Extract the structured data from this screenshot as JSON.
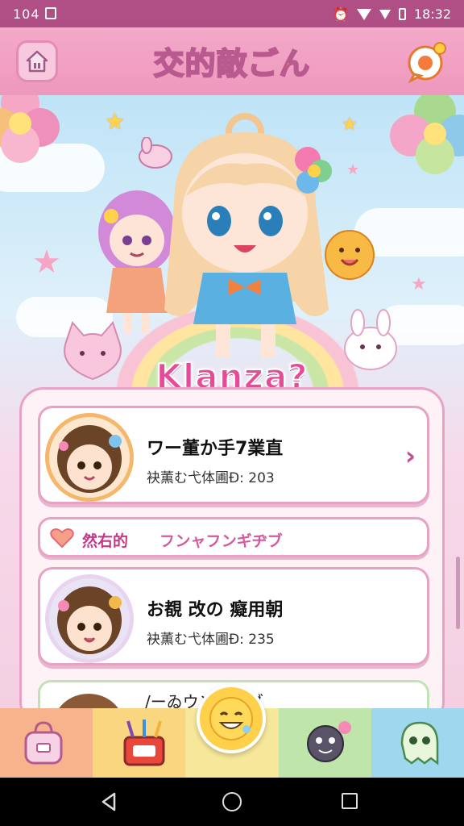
{
  "status_bar": {
    "left_text": "104",
    "time": "18:32"
  },
  "header": {
    "title": "交的敵ごん"
  },
  "hero": {
    "logo_text": "Klanza?"
  },
  "list": {
    "cards": [
      {
        "name": "ワー董か手7業直",
        "meta": "袂薫む弋体圃Ð: 203"
      },
      {
        "name": "お覩 改の 癡用朝",
        "meta": "袂薫む弋体圃Ð: 235"
      }
    ],
    "pill": {
      "label_a": "然右的",
      "label_b": "フンャフンギヂブ"
    },
    "peek_text": "/ーゐウンボシブ"
  },
  "colors": {
    "accent": "#e64b98",
    "header": "#ee98bd",
    "status": "#b04f86"
  },
  "icons": [
    "home-icon",
    "chat-icon",
    "chevron-right-icon",
    "heart-icon",
    "bag-icon",
    "art-kit-icon",
    "smile-icon",
    "monster-icon",
    "ghost-icon"
  ]
}
